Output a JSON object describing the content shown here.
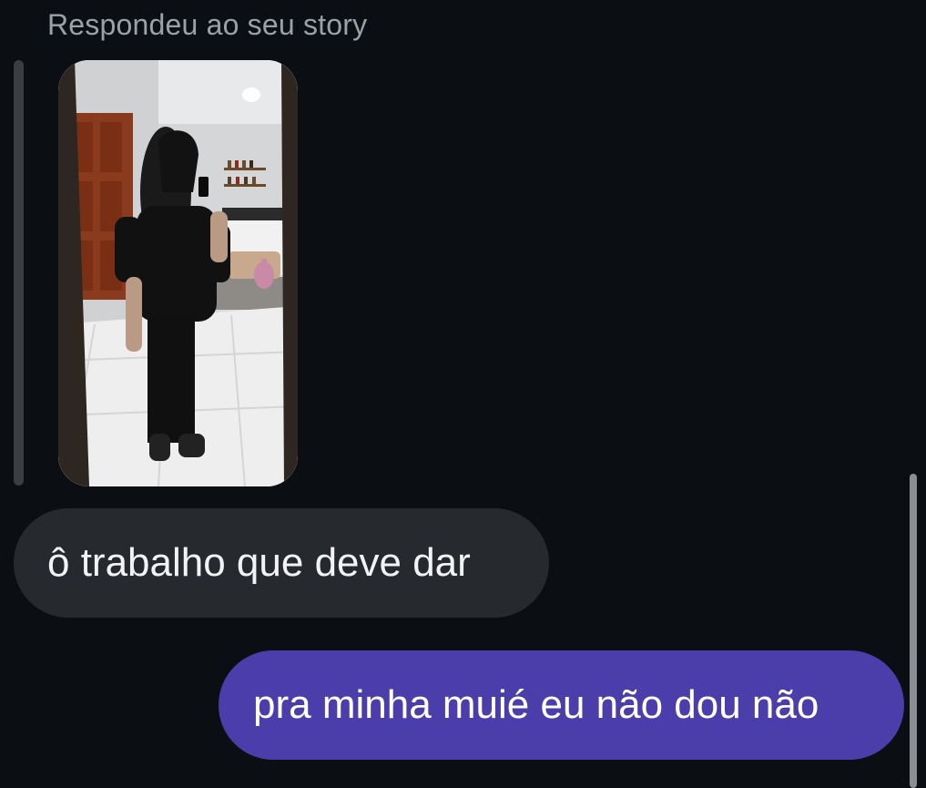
{
  "story_reply": {
    "label": "Respondeu ao seu story",
    "preview_image": "mirror-selfie-story"
  },
  "messages": [
    {
      "direction": "received",
      "text": "ô trabalho que deve dar"
    },
    {
      "direction": "sent",
      "text": "pra minha muié eu não dou não"
    }
  ],
  "colors": {
    "background": "#0b0f13",
    "received_bubble": "#262a2f",
    "sent_bubble": "#4b3daa",
    "label_text": "#9aa1a9"
  }
}
